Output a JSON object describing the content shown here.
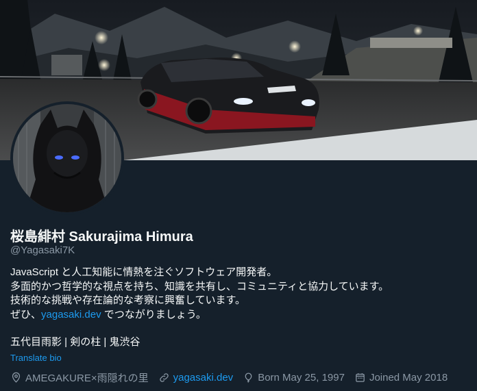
{
  "profile": {
    "display_name": "桜島緋村 Sakurajima Himura",
    "handle": "@Yagasaki7K"
  },
  "bio": {
    "line1": "JavaScript と人工知能に情熱を注ぐソフトウェア開発者。",
    "line2": "多面的かつ哲学的な視点を持ち、知識を共有し、コミュニティと協力しています。",
    "line3": "技術的な挑戦や存在論的な考察に興奮しています。",
    "line4_prefix": "ぜひ、",
    "line4_link": "yagasaki.dev",
    "line4_suffix": " でつながりましょう。",
    "line5": "五代目雨影 | 剣の柱 | 鬼渋谷"
  },
  "translate_label": "Translate bio",
  "meta": {
    "location": "AMEGAKURE×雨隠れの里",
    "website": "yagasaki.dev",
    "birthday": "Born May 25, 1997",
    "joined": "Joined May 2018"
  },
  "icons": {
    "location": "location-pin-icon",
    "website": "link-icon",
    "birthday": "balloon-icon",
    "joined": "calendar-icon"
  },
  "colors": {
    "background": "#15202b",
    "text": "#f7f9f9",
    "secondary": "#8b98a5",
    "accent": "#1d9bf0"
  }
}
